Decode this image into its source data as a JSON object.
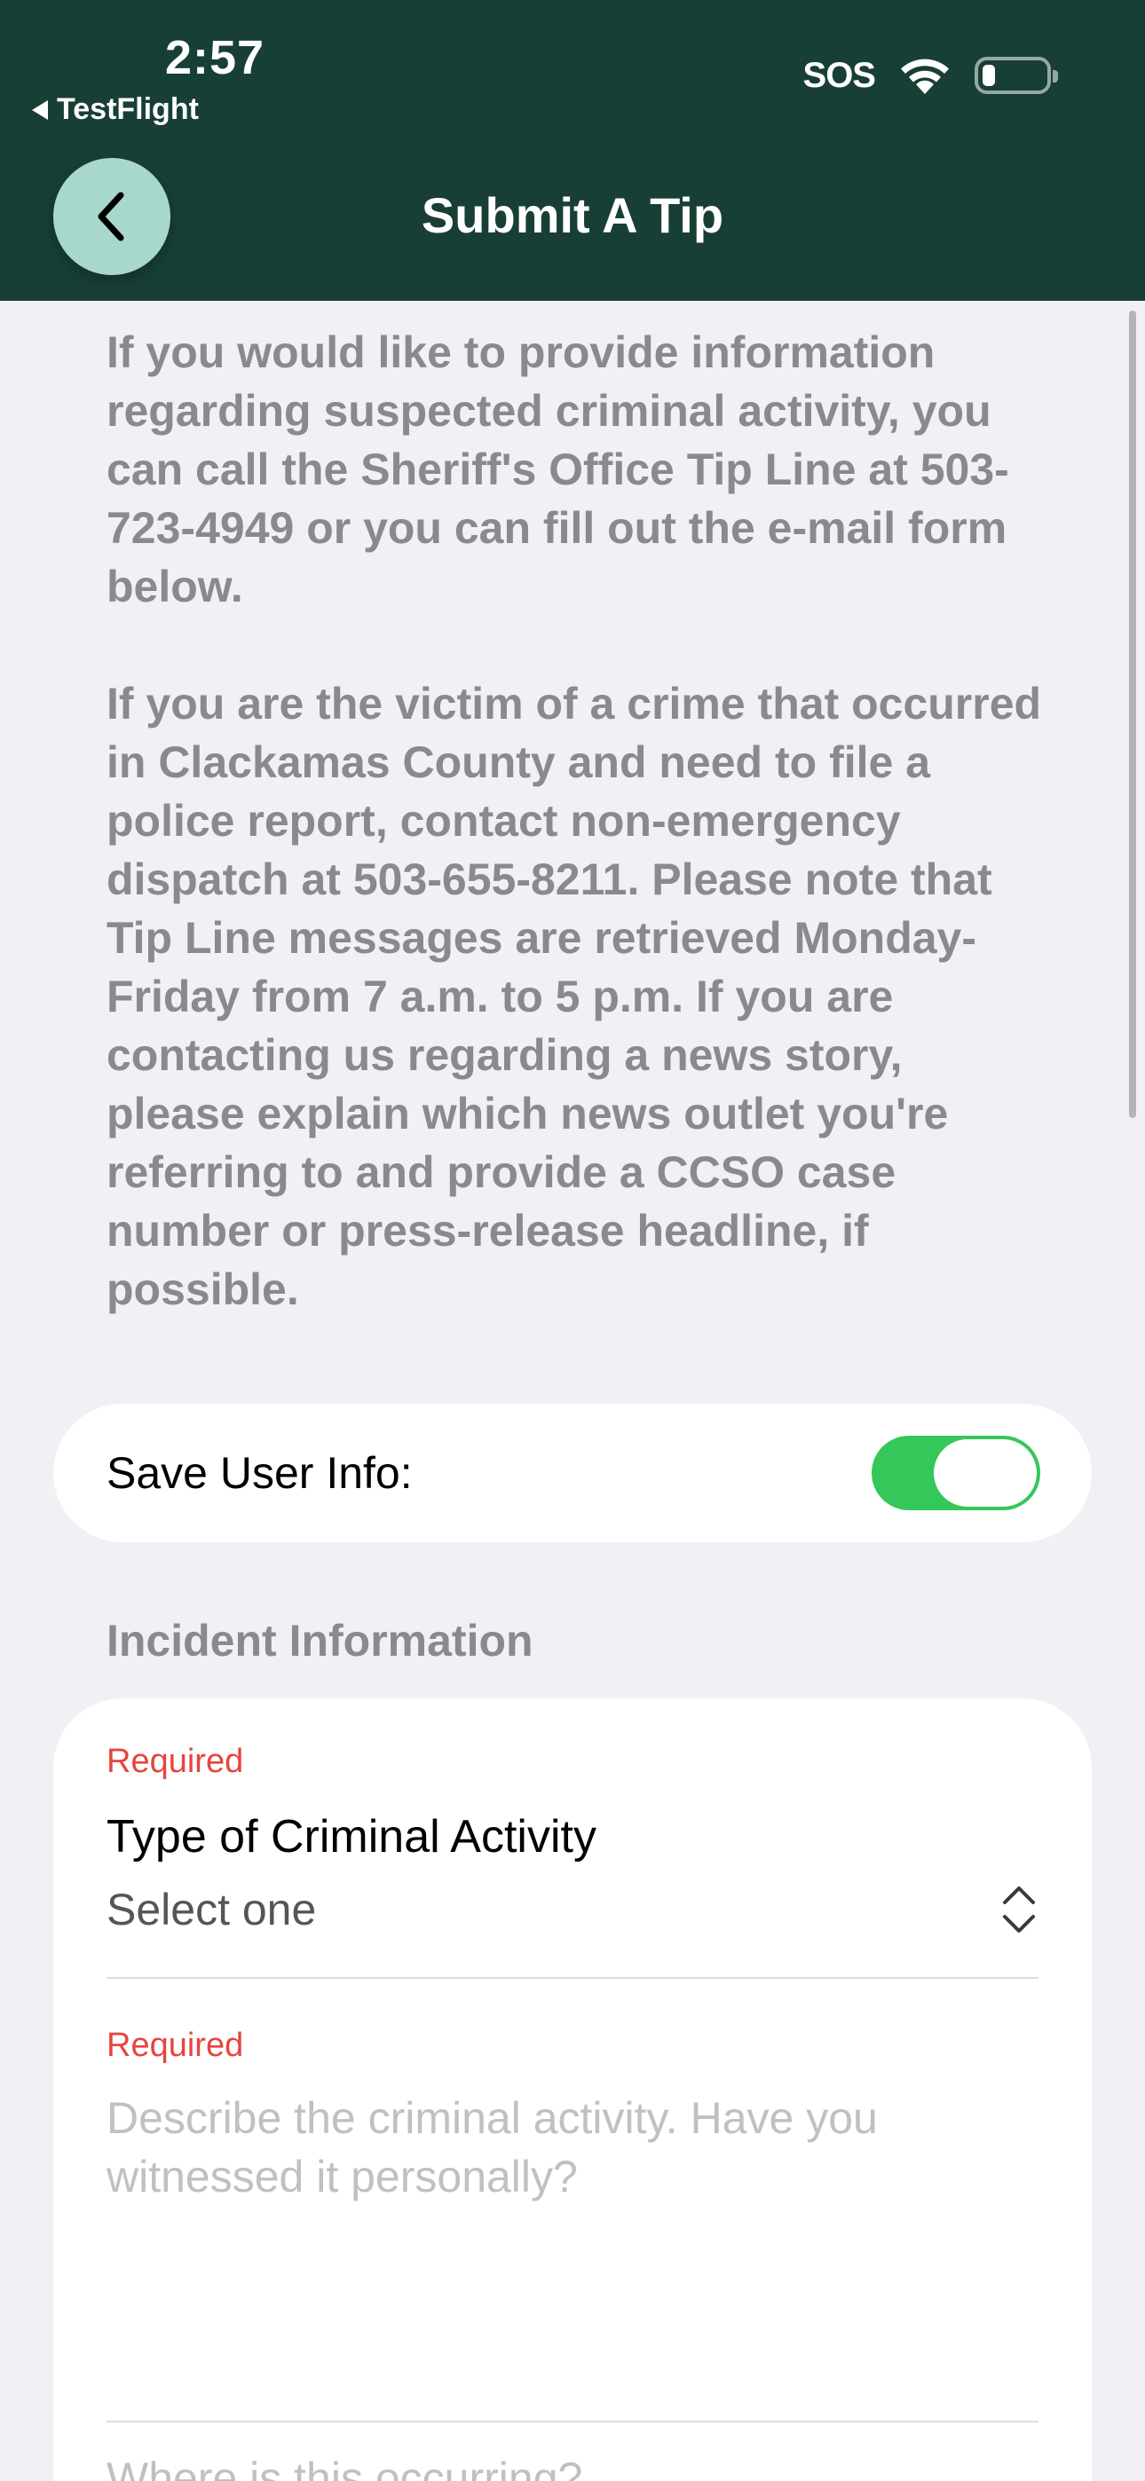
{
  "status_bar": {
    "time": "2:57",
    "back_app": "TestFlight",
    "sos": "SOS"
  },
  "nav": {
    "title": "Submit A Tip",
    "back_icon": "chevron-left-icon"
  },
  "intro": {
    "paragraph_1": "If you would like to provide information regarding suspected criminal activity, you can call the Sheriff's Office Tip Line at 503-723-4949 or you can fill out the e-mail form below.",
    "paragraph_2": "If you are the victim of a crime that occurred in Clackamas County and need to file a police report, contact non-emergency dispatch at 503-655-8211. Please note that Tip Line messages are retrieved Monday-Friday from 7 a.m. to 5 p.m. If you are contacting us regarding a news story, please explain which news outlet you're referring to and provide a CCSO case number or press-release headline, if possible."
  },
  "save_user_info": {
    "label": "Save User Info:",
    "enabled": true
  },
  "incident": {
    "section_title": "Incident Information",
    "type_field": {
      "required_label": "Required",
      "label": "Type of Criminal Activity",
      "value": "Select one"
    },
    "description_field": {
      "required_label": "Required",
      "placeholder": "Describe the criminal activity. Have you witnessed it personally?"
    },
    "location_field": {
      "placeholder": "Where is this occurring?"
    }
  },
  "colors": {
    "header_bg": "#183f36",
    "back_button_bg": "#a8d8cc",
    "toggle_on": "#34c759",
    "required": "#e6453f",
    "background": "#f1f0f5"
  }
}
